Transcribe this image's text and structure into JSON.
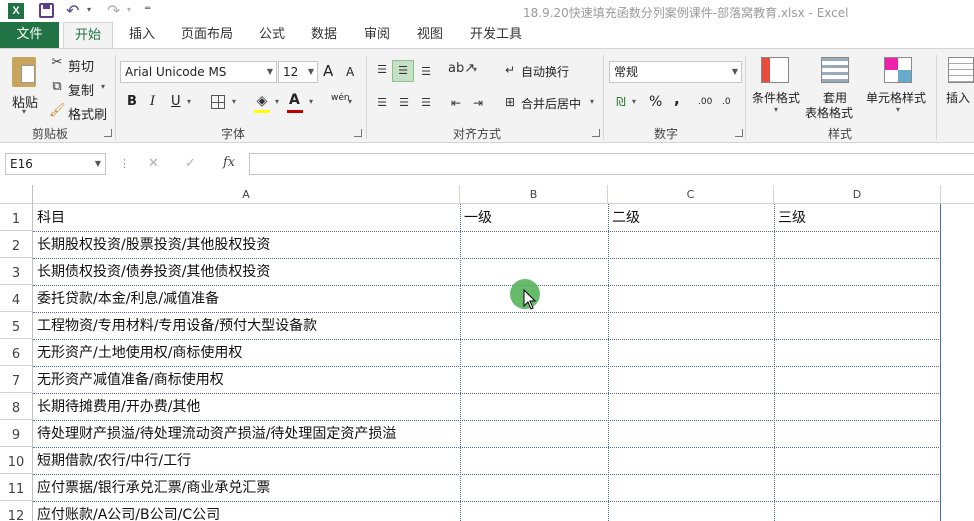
{
  "app": {
    "title": "18.9.20快速填充函数分列案例课件-部落窝教育.xlsx - Excel"
  },
  "quick_access": {
    "app_icon": "excel-icon",
    "save_icon": "save-icon",
    "undo_icon": "undo-icon",
    "redo_icon": "redo-icon",
    "customize_icon": "customize-qat-icon"
  },
  "tabs": {
    "file": "文件",
    "items": [
      "开始",
      "插入",
      "页面布局",
      "公式",
      "数据",
      "审阅",
      "视图",
      "开发工具"
    ],
    "active": "开始"
  },
  "ribbon": {
    "clipboard": {
      "paste": "粘贴",
      "cut": "剪切",
      "copy": "复制",
      "format_painter": "格式刷",
      "group_label": "剪贴板"
    },
    "font": {
      "font_name": "Arial Unicode MS",
      "font_size": "12",
      "grow": "A",
      "shrink": "A",
      "bold": "B",
      "italic": "I",
      "underline": "U",
      "phonetic": "wén",
      "group_label": "字体"
    },
    "alignment": {
      "wrap_text": "自动换行",
      "merge_center": "合并后居中",
      "group_label": "对齐方式"
    },
    "number": {
      "format": "常规",
      "percent": "%",
      "comma": ",",
      "inc_decimal": ".00",
      "dec_decimal": ".0",
      "group_label": "数字"
    },
    "styles": {
      "conditional": "条件格式",
      "format_table_line1": "套用",
      "format_table_line2": "表格格式",
      "cell_styles": "单元格样式",
      "group_label": "样式"
    },
    "cells": {
      "insert": "插入"
    }
  },
  "formula_bar": {
    "name_box": "E16",
    "cancel": "✕",
    "enter": "✓",
    "fx": "fx",
    "value": ""
  },
  "sheet": {
    "columns": [
      "A",
      "B",
      "C",
      "D"
    ],
    "row_numbers": [
      "1",
      "2",
      "3",
      "4",
      "5",
      "6",
      "7",
      "8",
      "9",
      "10",
      "11",
      "12"
    ],
    "rows": [
      [
        "科目",
        "一级",
        "二级",
        "三级"
      ],
      [
        "长期股权投资/股票投资/其他股权投资",
        "",
        "",
        ""
      ],
      [
        "长期债权投资/债券投资/其他债权投资",
        "",
        "",
        ""
      ],
      [
        "委托贷款/本金/利息/减值准备",
        "",
        "",
        ""
      ],
      [
        "工程物资/专用材料/专用设备/预付大型设备款",
        "",
        "",
        ""
      ],
      [
        "无形资产/土地使用权/商标使用权",
        "",
        "",
        ""
      ],
      [
        "无形资产减值准备/商标使用权",
        "",
        "",
        ""
      ],
      [
        "长期待摊费用/开办费/其他",
        "",
        "",
        ""
      ],
      [
        "待处理财产损溢/待处理流动资产损溢/待处理固定资产损溢",
        "",
        "",
        ""
      ],
      [
        "短期借款/农行/中行/工行",
        "",
        "",
        ""
      ],
      [
        "应付票据/银行承兑汇票/商业承兑汇票",
        "",
        "",
        ""
      ],
      [
        "应付账款/A公司/B公司/C公司",
        "",
        "",
        ""
      ]
    ]
  },
  "cursor": {
    "highlight_color": "#4caf50"
  },
  "colors": {
    "brand": "#217346",
    "grid_border": "#4a6fa5"
  }
}
